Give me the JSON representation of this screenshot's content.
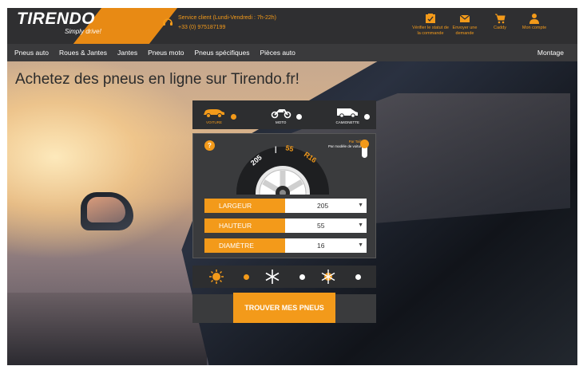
{
  "header": {
    "brand": "TIRENDO",
    "tagline": "Simply drive!",
    "service_hours": "Service client (Lundi-Vendredi : 7h-22h)",
    "service_phone": "+33 (0) 975187199",
    "icons": [
      {
        "icon": "order-status-icon",
        "label": "Vérifier le statut de la commande"
      },
      {
        "icon": "mail-icon",
        "label": "Envoyer une demande"
      },
      {
        "icon": "cart-icon",
        "label": "Caddy"
      },
      {
        "icon": "user-icon",
        "label": "Mon compte"
      }
    ]
  },
  "nav": {
    "items": [
      "Pneus auto",
      "Roues & Jantes",
      "Jantes",
      "Pneus moto",
      "Pneus spécifiques",
      "Pièces auto"
    ],
    "right": "Montage"
  },
  "hero": {
    "title": "Achetez des pneus en ligne sur Tirendo.fr!"
  },
  "finder": {
    "vehicles": [
      {
        "label": "VOITURE",
        "icon": "car-icon",
        "active": true
      },
      {
        "label": "MOTO",
        "icon": "motorcycle-icon",
        "active": false
      },
      {
        "label": "CAMIONETTE",
        "icon": "van-icon",
        "active": false
      }
    ],
    "help": "?",
    "toggle_active": "Par Taille",
    "toggle_other": "Par modèle de voiture",
    "tire_text": {
      "width": "205",
      "sep": "|",
      "height": "55",
      "rim": "R16"
    },
    "fields": [
      {
        "label": "LARGEUR",
        "value": "205"
      },
      {
        "label": "HAUTEUR",
        "value": "55"
      },
      {
        "label": "DIAMÈTRE",
        "value": "16"
      }
    ],
    "seasons": [
      {
        "icon": "sun-icon",
        "active": true
      },
      {
        "icon": "snowflake-icon",
        "active": false
      },
      {
        "icon": "all-season-icon",
        "active": false
      }
    ],
    "find_button": "TROUVER MES PNEUS"
  },
  "colors": {
    "accent": "#f39a1a",
    "header_bg": "#2f2f31",
    "nav_bg": "#3a3a3c",
    "panel_bg": "#3a3b3d"
  }
}
